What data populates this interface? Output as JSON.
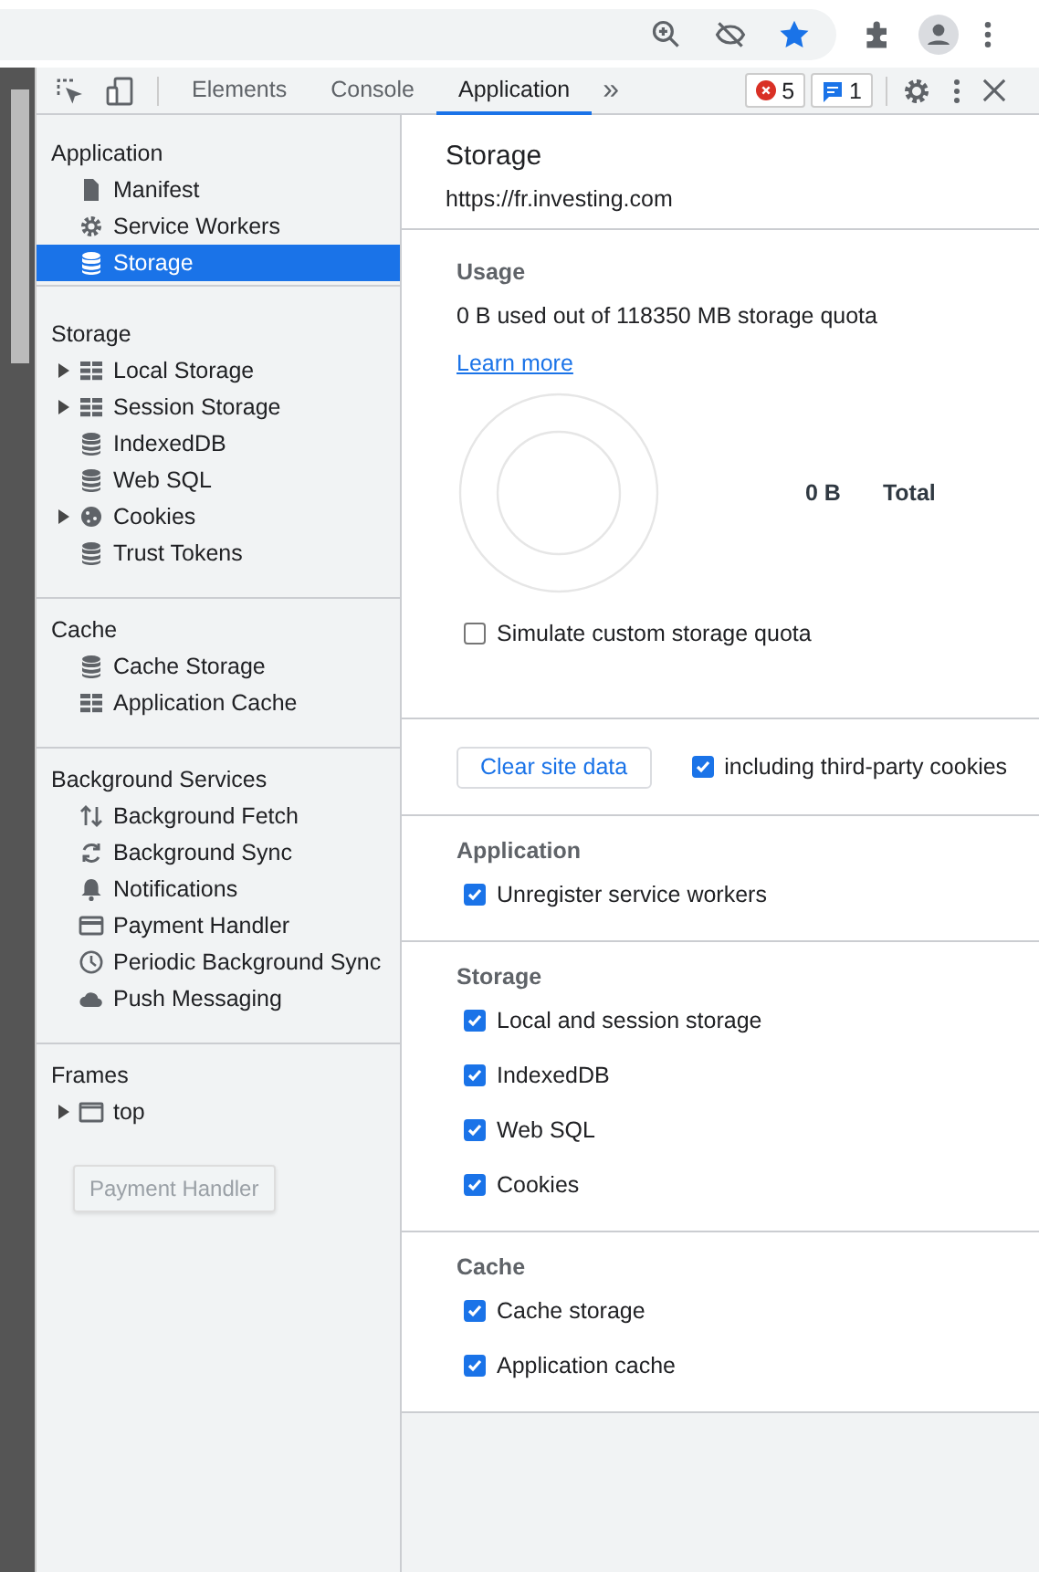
{
  "devtools_tabs": [
    {
      "label": "Elements",
      "selected": false
    },
    {
      "label": "Console",
      "selected": false
    },
    {
      "label": "Application",
      "selected": true
    }
  ],
  "more_tabs": "»",
  "error_count": "5",
  "message_count": "1",
  "sidebar": [
    {
      "title": "Application",
      "items": [
        {
          "label": "Manifest",
          "kind": "file",
          "expandable": false,
          "selected": false
        },
        {
          "label": "Service Workers",
          "kind": "gear",
          "expandable": false,
          "selected": false
        },
        {
          "label": "Storage",
          "kind": "database",
          "expandable": false,
          "selected": true
        }
      ]
    },
    {
      "title": "Storage",
      "items": [
        {
          "label": "Local Storage",
          "kind": "grid",
          "expandable": true,
          "selected": false
        },
        {
          "label": "Session Storage",
          "kind": "grid",
          "expandable": true,
          "selected": false
        },
        {
          "label": "IndexedDB",
          "kind": "database",
          "expandable": false,
          "selected": false
        },
        {
          "label": "Web SQL",
          "kind": "database",
          "expandable": false,
          "selected": false
        },
        {
          "label": "Cookies",
          "kind": "cookie",
          "expandable": true,
          "selected": false
        },
        {
          "label": "Trust Tokens",
          "kind": "database",
          "expandable": false,
          "selected": false
        }
      ]
    },
    {
      "title": "Cache",
      "items": [
        {
          "label": "Cache Storage",
          "kind": "database",
          "expandable": false,
          "selected": false
        },
        {
          "label": "Application Cache",
          "kind": "grid",
          "expandable": false,
          "selected": false
        }
      ]
    },
    {
      "title": "Background Services",
      "items": [
        {
          "label": "Background Fetch",
          "kind": "arrows",
          "expandable": false,
          "selected": false
        },
        {
          "label": "Background Sync",
          "kind": "sync",
          "expandable": false,
          "selected": false
        },
        {
          "label": "Notifications",
          "kind": "bell",
          "expandable": false,
          "selected": false
        },
        {
          "label": "Payment Handler",
          "kind": "card",
          "expandable": false,
          "selected": false
        },
        {
          "label": "Periodic Background Sync",
          "kind": "clock",
          "expandable": false,
          "selected": false
        },
        {
          "label": "Push Messaging",
          "kind": "cloud",
          "expandable": false,
          "selected": false
        }
      ]
    },
    {
      "title": "Frames",
      "items": [
        {
          "label": "top",
          "kind": "frame",
          "expandable": true,
          "selected": false
        }
      ]
    }
  ],
  "tooltip": "Payment Handler",
  "main": {
    "title": "Storage",
    "origin": "https://fr.investing.com",
    "usage": {
      "heading": "Usage",
      "text": "0 B used out of 118350 MB storage quota",
      "link": "Learn more",
      "total_value": "0 B",
      "total_label": "Total",
      "simulate_label": "Simulate custom storage quota",
      "simulate_checked": false
    },
    "clear_button": "Clear site data",
    "third_party": {
      "label": "including third-party cookies",
      "checked": true
    },
    "groups": [
      {
        "heading": "Application",
        "options": [
          {
            "label": "Unregister service workers",
            "checked": true
          }
        ]
      },
      {
        "heading": "Storage",
        "options": [
          {
            "label": "Local and session storage",
            "checked": true
          },
          {
            "label": "IndexedDB",
            "checked": true
          },
          {
            "label": "Web SQL",
            "checked": true
          },
          {
            "label": "Cookies",
            "checked": true
          }
        ]
      },
      {
        "heading": "Cache",
        "options": [
          {
            "label": "Cache storage",
            "checked": true
          },
          {
            "label": "Application cache",
            "checked": true
          }
        ]
      }
    ]
  }
}
